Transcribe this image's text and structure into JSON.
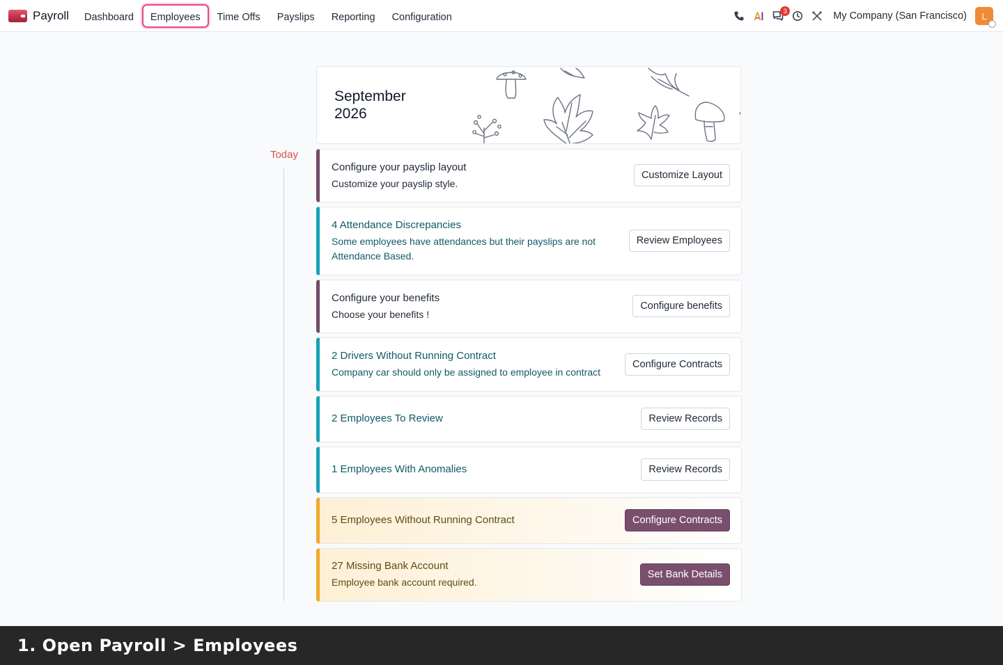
{
  "app": {
    "name": "Payroll"
  },
  "menu": {
    "items": [
      {
        "label": "Dashboard",
        "active": false
      },
      {
        "label": "Employees",
        "active": true
      },
      {
        "label": "Time Offs",
        "active": false
      },
      {
        "label": "Payslips",
        "active": false
      },
      {
        "label": "Reporting",
        "active": false
      },
      {
        "label": "Configuration",
        "active": false
      }
    ]
  },
  "systray": {
    "icons": [
      "phone-icon",
      "ai-icon",
      "chat-icon",
      "clock-icon",
      "tools-icon"
    ],
    "messages_badge": "3",
    "company": "My Company (San Francisco)",
    "avatar_initial": "L"
  },
  "calendar": {
    "month": "September",
    "year": "2026"
  },
  "timeline": {
    "today_label": "Today"
  },
  "steps": [
    {
      "title": "Configure your payslip layout",
      "desc": "Customize your payslip style.",
      "button": "Customize Layout",
      "style": "default"
    },
    {
      "title": "4 Attendance Discrepancies",
      "desc": "Some employees have attendances but their payslips are not Attendance Based.",
      "button": "Review Employees",
      "style": "teal"
    },
    {
      "title": "Configure your benefits",
      "desc": "Choose your benefits !",
      "button": "Configure benefits",
      "style": "default"
    },
    {
      "title": "2 Drivers Without Running Contract",
      "desc": "Company car should only be assigned to employee in contract",
      "button": "Configure Contracts",
      "style": "teal"
    },
    {
      "title": "2 Employees To Review",
      "desc": "",
      "button": "Review Records",
      "style": "teal"
    },
    {
      "title": "1 Employees With Anomalies",
      "desc": "",
      "button": "Review Records",
      "style": "teal"
    },
    {
      "title": "5 Employees Without Running Contract",
      "desc": "",
      "button": "Configure Contracts",
      "style": "warn"
    },
    {
      "title": "27 Missing Bank Account",
      "desc": "Employee bank account required.",
      "button": "Set Bank Details",
      "style": "warn"
    }
  ],
  "caption": "1. Open Payroll > Employees",
  "colors": {
    "accent": "#714b67",
    "teal": "#17a2b8",
    "warning": "#f0a929",
    "highlight": "#e3498a",
    "today": "#d9534f"
  }
}
